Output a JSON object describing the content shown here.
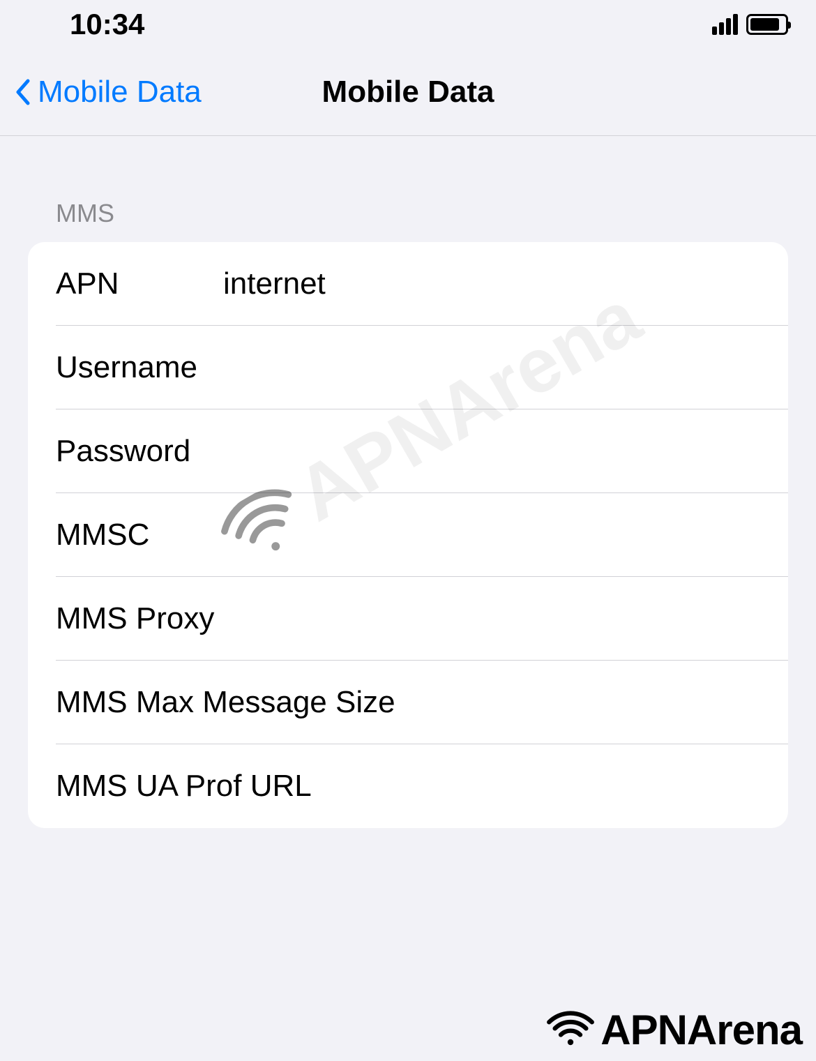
{
  "statusBar": {
    "time": "10:34"
  },
  "nav": {
    "backLabel": "Mobile Data",
    "title": "Mobile Data"
  },
  "section": {
    "header": "MMS"
  },
  "fields": {
    "apn": {
      "label": "APN",
      "value": "internet"
    },
    "username": {
      "label": "Username",
      "value": ""
    },
    "password": {
      "label": "Password",
      "value": ""
    },
    "mmsc": {
      "label": "MMSC",
      "value": ""
    },
    "mmsProxy": {
      "label": "MMS Proxy",
      "value": ""
    },
    "mmsMaxSize": {
      "label": "MMS Max Message Size",
      "value": ""
    },
    "mmsUaProf": {
      "label": "MMS UA Prof URL",
      "value": ""
    }
  },
  "watermark": {
    "text": "APNArena"
  }
}
